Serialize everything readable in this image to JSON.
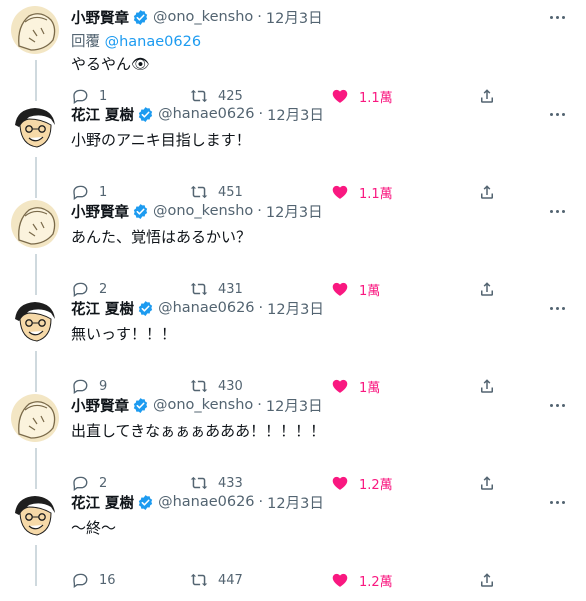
{
  "reply_prefix": "回覆",
  "reply_handle": "@hanae0626",
  "tweets": [
    {
      "name": "小野賢章",
      "handle": "@ono_kensho",
      "date": "12月3日",
      "text": "やるやん👁",
      "replies": "1",
      "retweets": "425",
      "likes": "1.1萬",
      "avatar": "ono"
    },
    {
      "name": "花江 夏樹",
      "handle": "@hanae0626",
      "date": "12月3日",
      "text": "小野のアニキ目指します！",
      "replies": "1",
      "retweets": "451",
      "likes": "1.1萬",
      "avatar": "hanae"
    },
    {
      "name": "小野賢章",
      "handle": "@ono_kensho",
      "date": "12月3日",
      "text": "あんた、覚悟はあるかい？",
      "replies": "2",
      "retweets": "431",
      "likes": "1萬",
      "avatar": "ono"
    },
    {
      "name": "花江 夏樹",
      "handle": "@hanae0626",
      "date": "12月3日",
      "text": "無いっす！！！",
      "replies": "9",
      "retweets": "430",
      "likes": "1萬",
      "avatar": "hanae"
    },
    {
      "name": "小野賢章",
      "handle": "@ono_kensho",
      "date": "12月3日",
      "text": "出直してきなぁぁぁあああ！！！！！",
      "replies": "2",
      "retweets": "433",
      "likes": "1.2萬",
      "avatar": "ono"
    },
    {
      "name": "花江 夏樹",
      "handle": "@hanae0626",
      "date": "12月3日",
      "text": "〜終〜",
      "replies": "16",
      "retweets": "447",
      "likes": "1.2萬",
      "avatar": "hanae"
    }
  ],
  "icons": {
    "verified": "verified-badge-icon",
    "more": "more-options-icon",
    "reply": "reply-bubble-icon",
    "retweet": "retweet-icon",
    "like": "heart-icon-liked",
    "share": "share-icon"
  },
  "colors": {
    "accent": "#1d9bf0",
    "like": "#f91880",
    "muted": "#536471",
    "thread_line": "#cfd9de"
  }
}
